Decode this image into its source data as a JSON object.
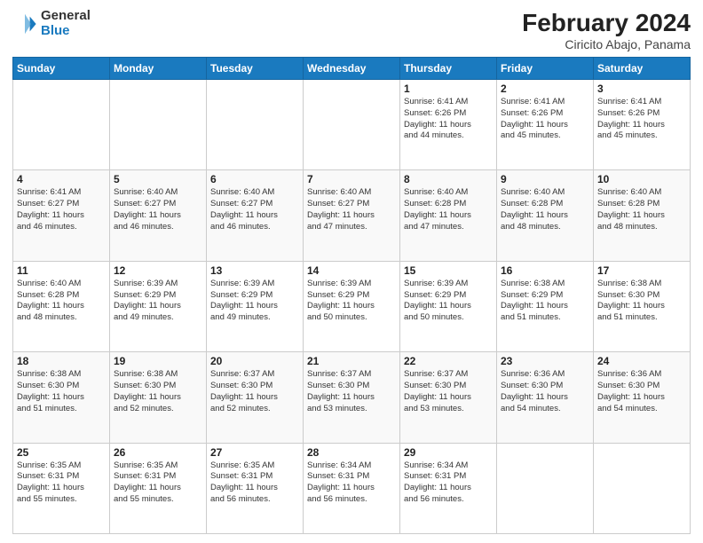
{
  "header": {
    "title": "February 2024",
    "subtitle": "Ciricito Abajo, Panama",
    "logo_general": "General",
    "logo_blue": "Blue"
  },
  "days_of_week": [
    "Sunday",
    "Monday",
    "Tuesday",
    "Wednesday",
    "Thursday",
    "Friday",
    "Saturday"
  ],
  "weeks": [
    [
      {
        "day": "",
        "info": ""
      },
      {
        "day": "",
        "info": ""
      },
      {
        "day": "",
        "info": ""
      },
      {
        "day": "",
        "info": ""
      },
      {
        "day": "1",
        "info": "Sunrise: 6:41 AM\nSunset: 6:26 PM\nDaylight: 11 hours\nand 44 minutes."
      },
      {
        "day": "2",
        "info": "Sunrise: 6:41 AM\nSunset: 6:26 PM\nDaylight: 11 hours\nand 45 minutes."
      },
      {
        "day": "3",
        "info": "Sunrise: 6:41 AM\nSunset: 6:26 PM\nDaylight: 11 hours\nand 45 minutes."
      }
    ],
    [
      {
        "day": "4",
        "info": "Sunrise: 6:41 AM\nSunset: 6:27 PM\nDaylight: 11 hours\nand 46 minutes."
      },
      {
        "day": "5",
        "info": "Sunrise: 6:40 AM\nSunset: 6:27 PM\nDaylight: 11 hours\nand 46 minutes."
      },
      {
        "day": "6",
        "info": "Sunrise: 6:40 AM\nSunset: 6:27 PM\nDaylight: 11 hours\nand 46 minutes."
      },
      {
        "day": "7",
        "info": "Sunrise: 6:40 AM\nSunset: 6:27 PM\nDaylight: 11 hours\nand 47 minutes."
      },
      {
        "day": "8",
        "info": "Sunrise: 6:40 AM\nSunset: 6:28 PM\nDaylight: 11 hours\nand 47 minutes."
      },
      {
        "day": "9",
        "info": "Sunrise: 6:40 AM\nSunset: 6:28 PM\nDaylight: 11 hours\nand 48 minutes."
      },
      {
        "day": "10",
        "info": "Sunrise: 6:40 AM\nSunset: 6:28 PM\nDaylight: 11 hours\nand 48 minutes."
      }
    ],
    [
      {
        "day": "11",
        "info": "Sunrise: 6:40 AM\nSunset: 6:28 PM\nDaylight: 11 hours\nand 48 minutes."
      },
      {
        "day": "12",
        "info": "Sunrise: 6:39 AM\nSunset: 6:29 PM\nDaylight: 11 hours\nand 49 minutes."
      },
      {
        "day": "13",
        "info": "Sunrise: 6:39 AM\nSunset: 6:29 PM\nDaylight: 11 hours\nand 49 minutes."
      },
      {
        "day": "14",
        "info": "Sunrise: 6:39 AM\nSunset: 6:29 PM\nDaylight: 11 hours\nand 50 minutes."
      },
      {
        "day": "15",
        "info": "Sunrise: 6:39 AM\nSunset: 6:29 PM\nDaylight: 11 hours\nand 50 minutes."
      },
      {
        "day": "16",
        "info": "Sunrise: 6:38 AM\nSunset: 6:29 PM\nDaylight: 11 hours\nand 51 minutes."
      },
      {
        "day": "17",
        "info": "Sunrise: 6:38 AM\nSunset: 6:30 PM\nDaylight: 11 hours\nand 51 minutes."
      }
    ],
    [
      {
        "day": "18",
        "info": "Sunrise: 6:38 AM\nSunset: 6:30 PM\nDaylight: 11 hours\nand 51 minutes."
      },
      {
        "day": "19",
        "info": "Sunrise: 6:38 AM\nSunset: 6:30 PM\nDaylight: 11 hours\nand 52 minutes."
      },
      {
        "day": "20",
        "info": "Sunrise: 6:37 AM\nSunset: 6:30 PM\nDaylight: 11 hours\nand 52 minutes."
      },
      {
        "day": "21",
        "info": "Sunrise: 6:37 AM\nSunset: 6:30 PM\nDaylight: 11 hours\nand 53 minutes."
      },
      {
        "day": "22",
        "info": "Sunrise: 6:37 AM\nSunset: 6:30 PM\nDaylight: 11 hours\nand 53 minutes."
      },
      {
        "day": "23",
        "info": "Sunrise: 6:36 AM\nSunset: 6:30 PM\nDaylight: 11 hours\nand 54 minutes."
      },
      {
        "day": "24",
        "info": "Sunrise: 6:36 AM\nSunset: 6:30 PM\nDaylight: 11 hours\nand 54 minutes."
      }
    ],
    [
      {
        "day": "25",
        "info": "Sunrise: 6:35 AM\nSunset: 6:31 PM\nDaylight: 11 hours\nand 55 minutes."
      },
      {
        "day": "26",
        "info": "Sunrise: 6:35 AM\nSunset: 6:31 PM\nDaylight: 11 hours\nand 55 minutes."
      },
      {
        "day": "27",
        "info": "Sunrise: 6:35 AM\nSunset: 6:31 PM\nDaylight: 11 hours\nand 56 minutes."
      },
      {
        "day": "28",
        "info": "Sunrise: 6:34 AM\nSunset: 6:31 PM\nDaylight: 11 hours\nand 56 minutes."
      },
      {
        "day": "29",
        "info": "Sunrise: 6:34 AM\nSunset: 6:31 PM\nDaylight: 11 hours\nand 56 minutes."
      },
      {
        "day": "",
        "info": ""
      },
      {
        "day": "",
        "info": ""
      }
    ]
  ]
}
